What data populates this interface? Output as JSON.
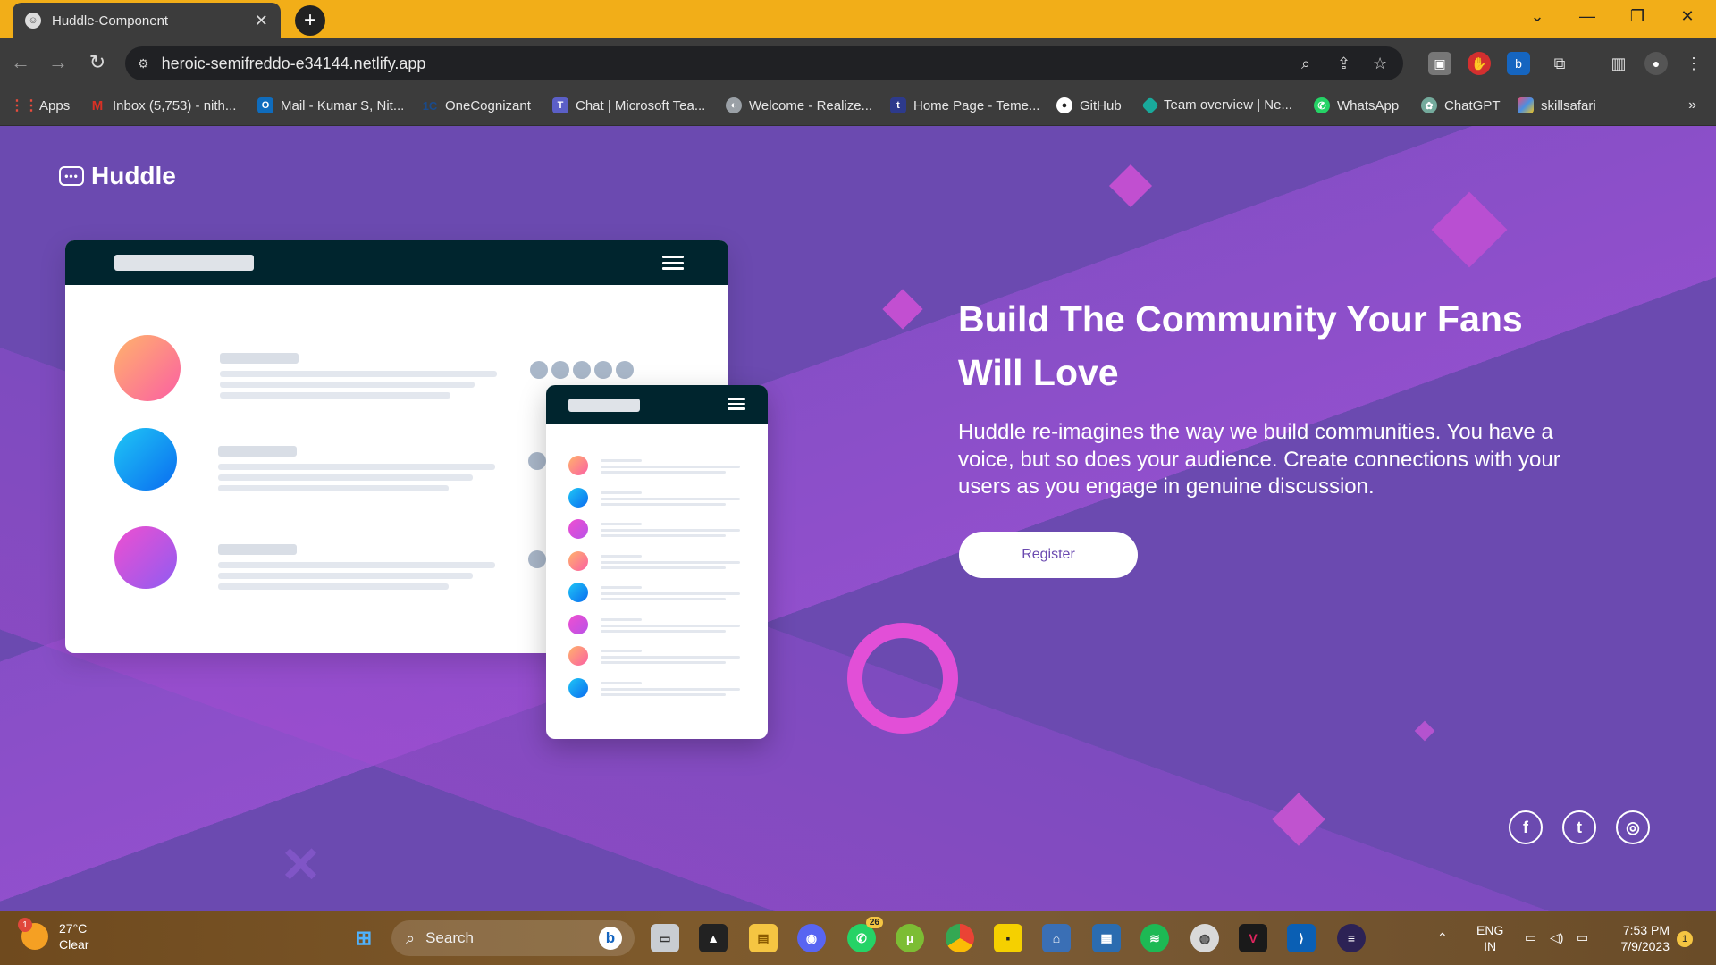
{
  "browser": {
    "tab_title": "Huddle-Component",
    "url": "heroic-semifreddo-e34144.netlify.app",
    "bookmarks": [
      {
        "label": "Apps",
        "icon": "apps-grid-icon",
        "color": "#e84c3d"
      },
      {
        "label": "Inbox (5,753) - nith...",
        "icon": "gmail-icon",
        "color": "#d93025"
      },
      {
        "label": "Mail - Kumar S, Nit...",
        "icon": "outlook-icon",
        "color": "#0f6cbd"
      },
      {
        "label": "OneCognizant",
        "icon": "onecognizant-icon",
        "color": "#1a4a8a"
      },
      {
        "label": "Chat | Microsoft Tea...",
        "icon": "teams-icon",
        "color": "#5b5fc7"
      },
      {
        "label": "Welcome - Realize...",
        "icon": "realize-icon",
        "color": "#9aa0a6"
      },
      {
        "label": "Home Page - Teme...",
        "icon": "teme-icon",
        "color": "#2d3a8c"
      },
      {
        "label": "GitHub",
        "icon": "github-icon",
        "color": "#ffffff"
      },
      {
        "label": "Team overview | Ne...",
        "icon": "team-overview-icon",
        "color": "#19a99b"
      },
      {
        "label": "WhatsApp",
        "icon": "whatsapp-icon",
        "color": "#25d366"
      },
      {
        "label": "ChatGPT",
        "icon": "chatgpt-icon",
        "color": "#74aa9c"
      },
      {
        "label": "skillsafari",
        "icon": "skillsafari-icon",
        "color": "#e94e77"
      }
    ]
  },
  "page": {
    "logo_text": "Huddle",
    "headline": "Build The Community Your Fans Will Love",
    "description": "Huddle re-imagines the way we build communities. You have a voice, but so does your audience. Create connections with your users as you engage in genuine discussion.",
    "register_label": "Register",
    "social": [
      {
        "name": "facebook-icon",
        "glyph": "f"
      },
      {
        "name": "twitter-icon",
        "glyph": "t"
      },
      {
        "name": "instagram-icon",
        "glyph": "◎"
      }
    ],
    "colors": {
      "background": "#6b4ab0",
      "button_text": "#6b4ab0",
      "mockup_header": "#00252e",
      "ring": "#e24fd7"
    }
  },
  "taskbar": {
    "weather_temp": "27°C",
    "weather_desc": "Clear",
    "weather_badge": "1",
    "search_placeholder": "Search",
    "whatsapp_badge": "26",
    "lang_top": "ENG",
    "lang_bottom": "IN",
    "time": "7:53 PM",
    "date": "7/9/2023",
    "notification_count": "1"
  }
}
